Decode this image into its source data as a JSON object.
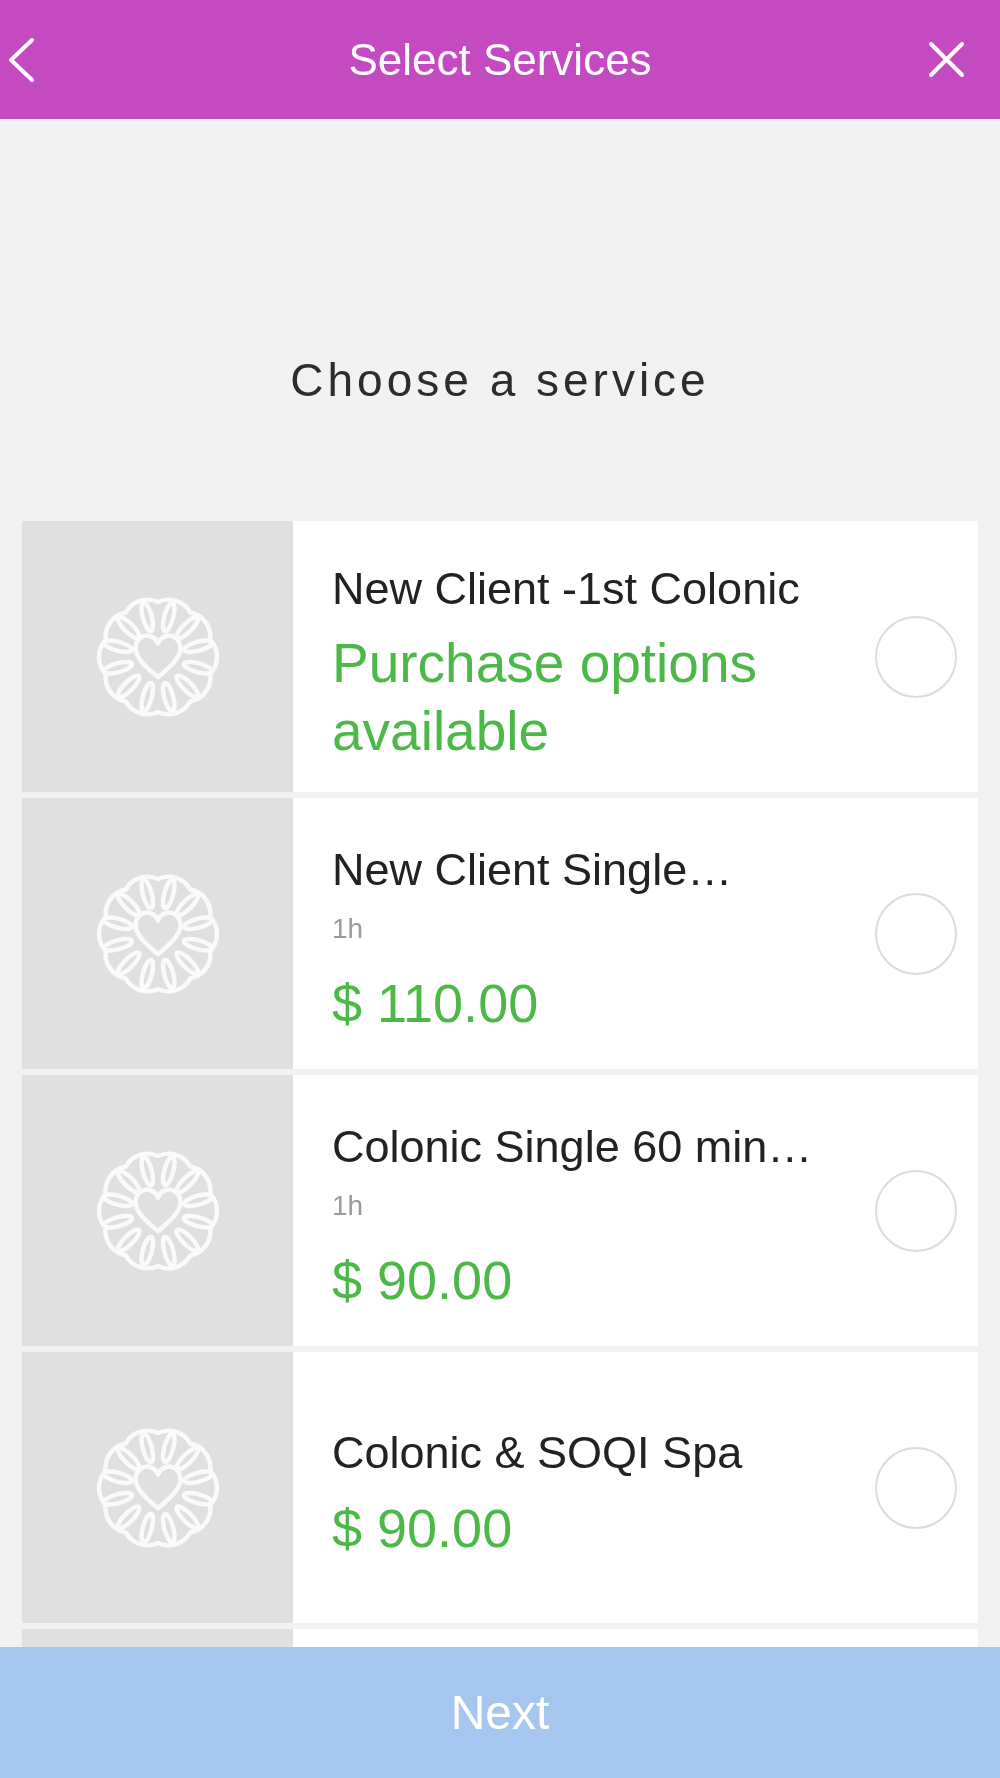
{
  "header": {
    "title": "Select Services"
  },
  "heading": "Choose a service",
  "services": [
    {
      "title": "New Client -1st Colonic",
      "note": "Purchase options available",
      "selected": false
    },
    {
      "title": "New Client Single…",
      "duration": "1h",
      "price": "$ 110.00",
      "selected": false
    },
    {
      "title": "Colonic Single 60 min…",
      "duration": "1h",
      "price": "$ 90.00",
      "selected": false
    },
    {
      "title": "Colonic & SOQI Spa",
      "price": "$ 90.00",
      "selected": false
    }
  ],
  "more_services_below": true,
  "next_button": {
    "label": "Next",
    "disabled": true
  }
}
